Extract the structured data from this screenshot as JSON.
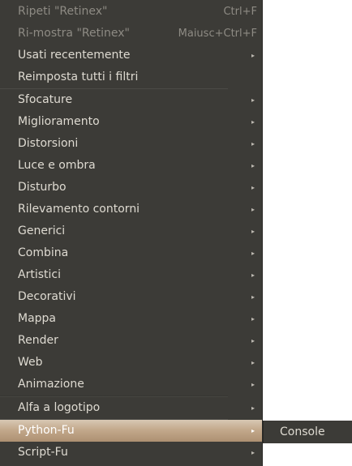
{
  "menu": {
    "repeat": {
      "label": "Ripeti \"Retinex\"",
      "accel": "Ctrl+F"
    },
    "reshow": {
      "label": "Ri-mostra \"Retinex\"",
      "accel": "Maiusc+Ctrl+F"
    },
    "recent": {
      "label": "Usati recentemente"
    },
    "reset": {
      "label": "Reimposta tutti i filtri"
    },
    "categories": [
      "Sfocature",
      "Miglioramento",
      "Distorsioni",
      "Luce e ombra",
      "Disturbo",
      "Rilevamento contorni",
      "Generici",
      "Combina",
      "Artistici",
      "Decorativi",
      "Mappa",
      "Render",
      "Web",
      "Animazione"
    ],
    "alpha_logo": {
      "label": "Alfa a logotipo"
    },
    "python_fu": {
      "label": "Python-Fu"
    },
    "script_fu": {
      "label": "Script-Fu"
    },
    "submenu_arrow": "▸"
  },
  "submenu": {
    "console": {
      "label": "Console"
    }
  },
  "colors": {
    "menu_background": "#3c3b37",
    "menu_text": "#dfdbd2",
    "disabled_text": "#8e8b84",
    "highlight": "#c3a98c"
  }
}
